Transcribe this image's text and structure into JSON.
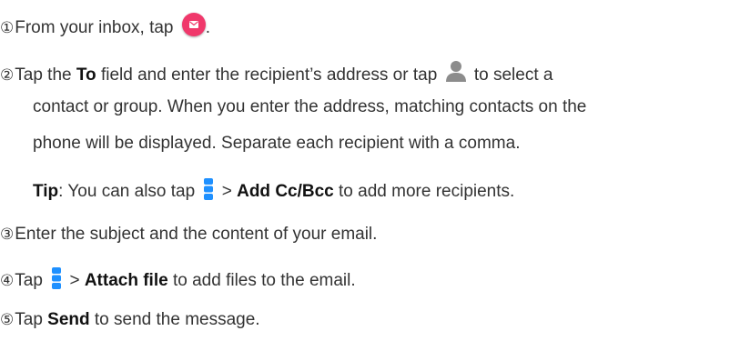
{
  "steps": [
    {
      "num": "①",
      "before": "From your inbox, tap ",
      "after": ".",
      "icon": "compose-email-icon"
    },
    {
      "num": "②",
      "part1": "Tap the ",
      "bold1": "To",
      "part2": " field and enter the recipient’s address or tap ",
      "icon": "contact-person-icon",
      "part3": " to select a",
      "line2": "contact or group. When you enter the address, matching contacts on the",
      "line3": "phone will be displayed. Separate each recipient with a comma."
    },
    {
      "tip_label": "Tip",
      "part1": ": You can also tap ",
      "icon": "more-options-icon",
      "part2": " > ",
      "bold": "Add Cc/Bcc",
      "part3": " to add more recipients."
    },
    {
      "num": "③",
      "text": "Enter the subject and the content of your email."
    },
    {
      "num": "④",
      "part1": "Tap ",
      "icon": "more-options-icon",
      "part2": " > ",
      "bold": "Attach file",
      "part3": " to add files to the email."
    },
    {
      "num": "⑤",
      "part1": "Tap ",
      "bold": "Send",
      "part2": " to send the message."
    }
  ],
  "colors": {
    "text": "#333333",
    "email_icon_bg": "#f0386b",
    "person_icon": "#8c8c8c",
    "menu_icon": "#1e90ff"
  }
}
